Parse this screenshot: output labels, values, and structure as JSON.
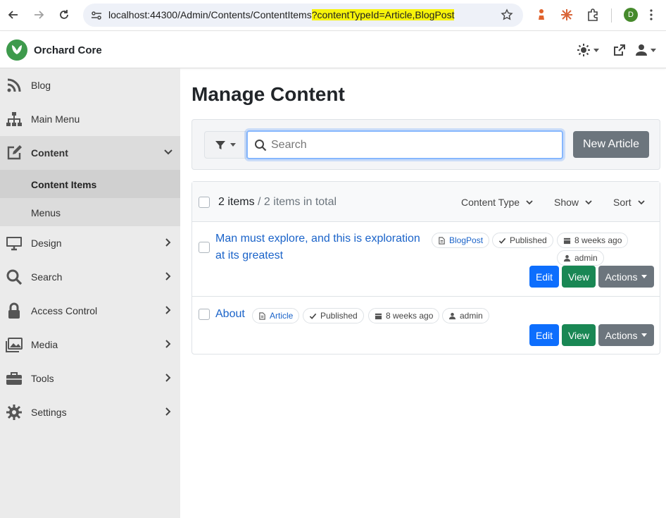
{
  "browser": {
    "url_base": "localhost:44300/Admin/Contents/ContentItems",
    "url_query": "?contentTypeId=Article,BlogPost",
    "profile_initial": "D"
  },
  "header": {
    "brand": "Orchard Core",
    "brand_color": "#3e9a4c"
  },
  "sidebar": {
    "items": [
      {
        "label": "Blog",
        "icon": "rss-icon"
      },
      {
        "label": "Main Menu",
        "icon": "sitemap-icon"
      },
      {
        "label": "Content",
        "icon": "edit-icon",
        "expanded": true
      },
      {
        "label": "Design",
        "icon": "desktop-icon"
      },
      {
        "label": "Search",
        "icon": "search-icon"
      },
      {
        "label": "Access Control",
        "icon": "lock-icon"
      },
      {
        "label": "Media",
        "icon": "images-icon"
      },
      {
        "label": "Tools",
        "icon": "toolbox-icon"
      },
      {
        "label": "Settings",
        "icon": "gear-icon"
      }
    ],
    "content_sub": [
      {
        "label": "Content Items",
        "current": true
      },
      {
        "label": "Menus",
        "current": false
      }
    ]
  },
  "main": {
    "title": "Manage Content",
    "search_placeholder": "Search",
    "new_button": "New Article",
    "list": {
      "count": "2 items",
      "total": " / 2 items in total",
      "content_type": "Content Type",
      "show": "Show",
      "sort": "Sort",
      "items": [
        {
          "title_line1": "Man must explore, and this is exploration",
          "title_line2": "at its greatest",
          "type": "BlogPost",
          "status": "Published",
          "modified": "8 weeks ago",
          "author": "admin"
        },
        {
          "title_line1": "About",
          "type": "Article",
          "status": "Published",
          "modified": "8 weeks ago",
          "author": "admin"
        }
      ],
      "edit": "Edit",
      "view": "View",
      "actions": "Actions"
    }
  },
  "colors": {
    "primary": "#0d6efd",
    "success": "#198754",
    "secondary": "#6c757d",
    "link": "#1a63c9",
    "highlight": "#f7f30b"
  }
}
